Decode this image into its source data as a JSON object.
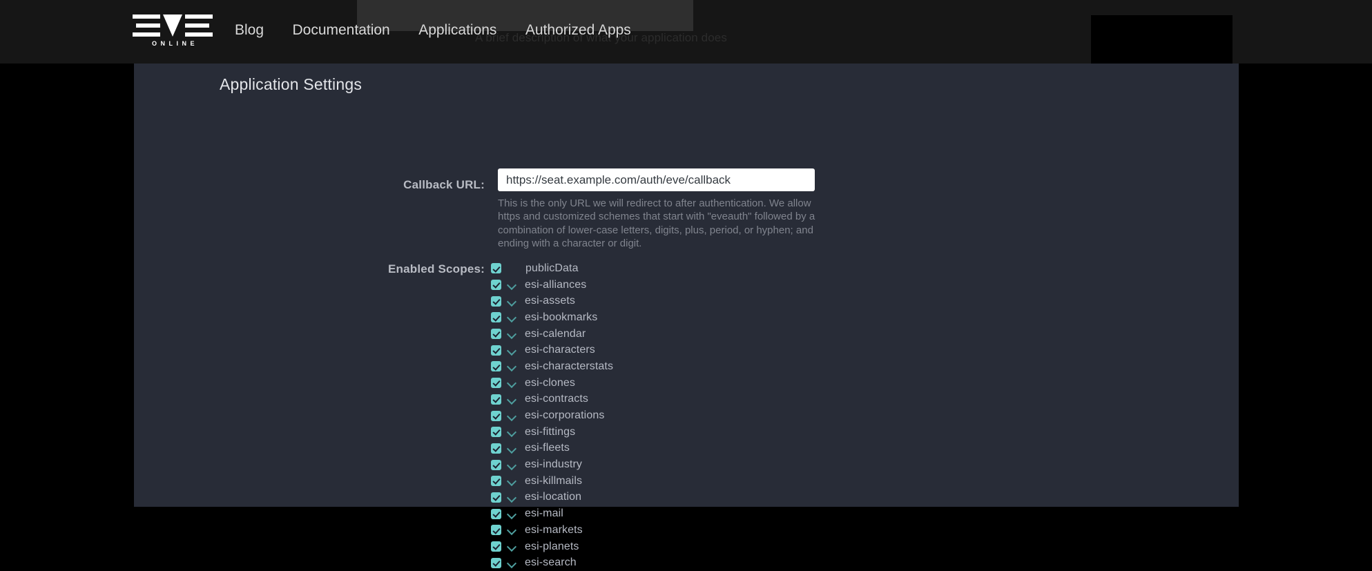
{
  "site": {
    "logo": {
      "name": "EVE",
      "subtitle": "ONLINE"
    },
    "nav": [
      {
        "label": "Blog"
      },
      {
        "label": "Documentation"
      },
      {
        "label": "Applications"
      },
      {
        "label": "Authorized Apps"
      }
    ]
  },
  "background_text": {
    "description_ghost": "A brief description of what your application does"
  },
  "main": {
    "title": "Application Settings",
    "callback": {
      "label": "Callback URL:",
      "value": "https://seat.example.com/auth/eve/callback",
      "placeholder": "https://seat.example.com/auth/eve/callback",
      "help": "This is the only URL we will redirect to after authentication. We allow https and customized schemes that start with \"eveauth\" followed by a combination of lower-case letters, digits, plus, period, or hyphen; and ending with a character or digit."
    },
    "scopes": {
      "label": "Enabled Scopes:",
      "items": [
        {
          "name": "publicData",
          "checked": true,
          "expandable": false
        },
        {
          "name": "esi-alliances",
          "checked": true,
          "expandable": true
        },
        {
          "name": "esi-assets",
          "checked": true,
          "expandable": true
        },
        {
          "name": "esi-bookmarks",
          "checked": true,
          "expandable": true
        },
        {
          "name": "esi-calendar",
          "checked": true,
          "expandable": true
        },
        {
          "name": "esi-characters",
          "checked": true,
          "expandable": true
        },
        {
          "name": "esi-characterstats",
          "checked": true,
          "expandable": true
        },
        {
          "name": "esi-clones",
          "checked": true,
          "expandable": true
        },
        {
          "name": "esi-contracts",
          "checked": true,
          "expandable": true
        },
        {
          "name": "esi-corporations",
          "checked": true,
          "expandable": true
        },
        {
          "name": "esi-fittings",
          "checked": true,
          "expandable": true
        },
        {
          "name": "esi-fleets",
          "checked": true,
          "expandable": true
        },
        {
          "name": "esi-industry",
          "checked": true,
          "expandable": true
        },
        {
          "name": "esi-killmails",
          "checked": true,
          "expandable": true
        },
        {
          "name": "esi-location",
          "checked": true,
          "expandable": true
        },
        {
          "name": "esi-mail",
          "checked": true,
          "expandable": true
        },
        {
          "name": "esi-markets",
          "checked": true,
          "expandable": true
        },
        {
          "name": "esi-planets",
          "checked": true,
          "expandable": true
        },
        {
          "name": "esi-search",
          "checked": true,
          "expandable": true
        }
      ]
    }
  },
  "colors": {
    "page_background": "#000000",
    "header_background": "#161616",
    "panel_background": "#282c37",
    "accent_checkbox": "#6fd2cf",
    "accent_chevron": "#4e9e9e",
    "input_background": "#ffffff",
    "text_primary": "#e3e5e9",
    "text_muted": "#80848e"
  }
}
